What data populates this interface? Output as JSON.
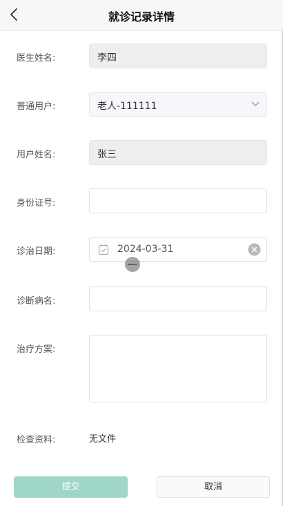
{
  "header": {
    "title": "就诊记录详情",
    "back_icon": "chevron-left-icon"
  },
  "form": {
    "doctor_name": {
      "label": "医生姓名:",
      "value": "李四"
    },
    "normal_user": {
      "label": "普通用户:",
      "value": "老人-111111"
    },
    "user_name": {
      "label": "用户姓名:",
      "value": "张三"
    },
    "id_number": {
      "label": "身份证号:",
      "value": ""
    },
    "visit_date": {
      "label": "诊治日期:",
      "value": "2024-03-31"
    },
    "diagnosis": {
      "label": "诊断病名:",
      "value": ""
    },
    "treatment": {
      "label": "治疗方案:",
      "value": ""
    },
    "exam_files": {
      "label": "检查资料:",
      "value": "无文件"
    }
  },
  "actions": {
    "submit_label": "提交",
    "cancel_label": "取消"
  },
  "colors": {
    "submit_bg": "#9fd6c8",
    "header_bg": "#f7f7f7",
    "disabled_bg": "#eeeeee"
  }
}
